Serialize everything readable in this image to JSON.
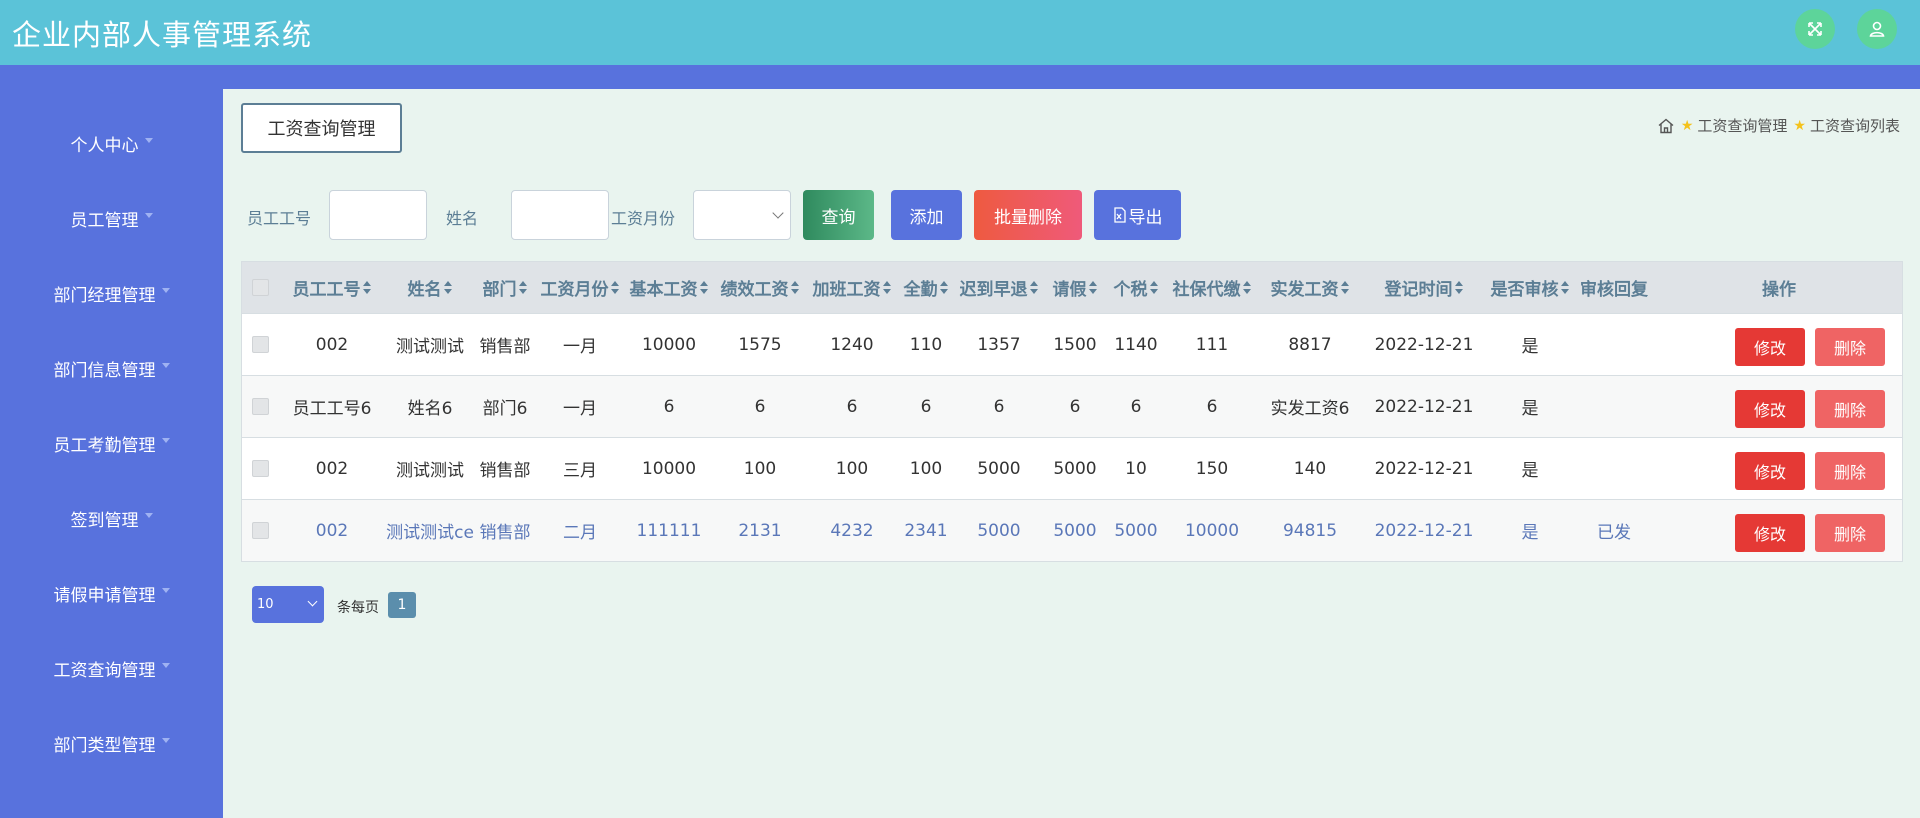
{
  "header": {
    "title": "企业内部人事管理系统",
    "fullscreen_icon": "fullscreen-icon",
    "user_icon": "user-icon"
  },
  "sidebar": {
    "items": [
      {
        "label": "个人中心"
      },
      {
        "label": "员工管理"
      },
      {
        "label": "部门经理管理"
      },
      {
        "label": "部门信息管理"
      },
      {
        "label": "员工考勤管理"
      },
      {
        "label": "签到管理"
      },
      {
        "label": "请假申请管理"
      },
      {
        "label": "工资查询管理"
      },
      {
        "label": "部门类型管理"
      }
    ]
  },
  "page": {
    "title": "工资查询管理",
    "breadcrumb": [
      "工资查询管理",
      "工资查询列表"
    ]
  },
  "search": {
    "employee_no_label": "员工工号",
    "employee_no_value": "",
    "name_label": "姓名",
    "name_value": "",
    "month_label": "工资月份",
    "month_value": "",
    "query_btn": "查询",
    "add_btn": "添加",
    "batch_delete_btn": "批量删除",
    "export_btn": "导出"
  },
  "colors": {
    "header": "#5bc3d8",
    "sidebar": "#5872dd",
    "query": "#3e9a6b",
    "add": "#5872dd",
    "batch_delete": "#ef5252",
    "export": "#5872dd",
    "edit": "#e53935",
    "delete": "#ef6464"
  },
  "table": {
    "headers": [
      "员工工号",
      "姓名",
      "部门",
      "工资月份",
      "基本工资",
      "绩效工资",
      "加班工资",
      "全勤",
      "迟到早退",
      "请假",
      "个税",
      "社保代缴",
      "实发工资",
      "登记时间",
      "是否审核",
      "审核回复",
      "操作"
    ],
    "rows": [
      [
        "002",
        "测试测试",
        "销售部",
        "一月",
        "10000",
        "1575",
        "1240",
        "110",
        "1357",
        "1500",
        "1140",
        "111",
        "8817",
        "2022-12-21",
        "是",
        ""
      ],
      [
        "员工工号6",
        "姓名6",
        "部门6",
        "一月",
        "6",
        "6",
        "6",
        "6",
        "6",
        "6",
        "6",
        "6",
        "实发工资6",
        "2022-12-21",
        "是",
        ""
      ],
      [
        "002",
        "测试测试",
        "销售部",
        "三月",
        "10000",
        "100",
        "100",
        "100",
        "5000",
        "5000",
        "10",
        "150",
        "140",
        "2022-12-21",
        "是",
        ""
      ],
      [
        "002",
        "测试测试ce",
        "销售部",
        "二月",
        "111111",
        "2131",
        "4232",
        "2341",
        "5000",
        "5000",
        "5000",
        "10000",
        "94815",
        "2022-12-21",
        "是",
        "已发"
      ]
    ],
    "edit_label": "修改",
    "delete_label": "删除"
  },
  "pagination": {
    "page_size": "10",
    "per_page_text": "条每页",
    "current_page": "1"
  }
}
